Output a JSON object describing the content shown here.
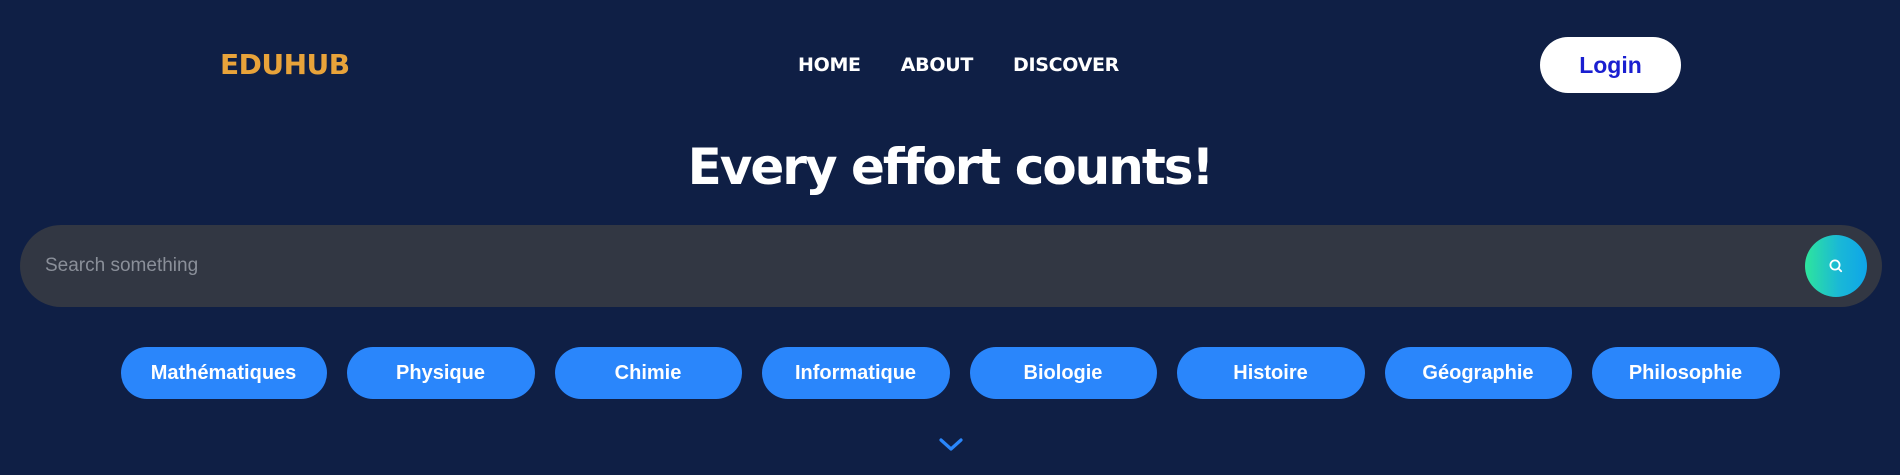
{
  "header": {
    "logo": "EDUHUB",
    "nav": [
      {
        "label": "HOME"
      },
      {
        "label": "ABOUT"
      },
      {
        "label": "DISCOVER"
      }
    ],
    "login_label": "Login"
  },
  "hero": {
    "title": "Every effort counts!"
  },
  "search": {
    "placeholder": "Search something",
    "button_icon": "search-icon"
  },
  "subjects": [
    {
      "label": "Mathématiques"
    },
    {
      "label": "Physique"
    },
    {
      "label": "Chimie"
    },
    {
      "label": "Informatique"
    },
    {
      "label": "Biologie"
    },
    {
      "label": "Histoire"
    },
    {
      "label": "Géographie"
    },
    {
      "label": "Philosophie"
    }
  ],
  "scroll_icon": "chevron-down-icon",
  "colors": {
    "background": "#0f1f45",
    "logo": "#e8a33a",
    "login_text": "#1a1fd0",
    "pill": "#2a86fb",
    "search_bar": "#323743",
    "search_gradient_start": "#2ee59d",
    "search_gradient_end": "#0ea5e9"
  }
}
